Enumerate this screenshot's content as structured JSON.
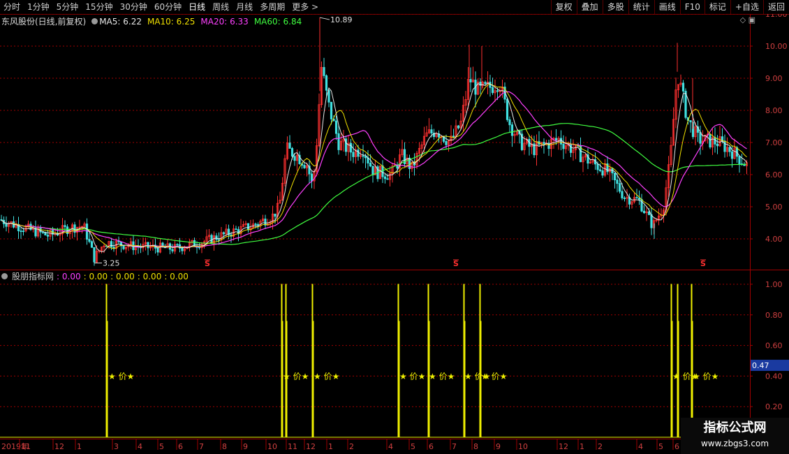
{
  "toolbar": {
    "periods": [
      "分时",
      "1分钟",
      "5分钟",
      "15分钟",
      "30分钟",
      "60分钟",
      "日线",
      "周线",
      "月线",
      "多周期"
    ],
    "active_period": "日线",
    "more": "更多 >",
    "buttons": [
      "复权",
      "叠加",
      "多股",
      "统计",
      "画线",
      "F10",
      "标记",
      "+自选",
      "返回"
    ]
  },
  "stock": {
    "name": "东风股份(日线,前复权)",
    "ma5": "MA5: 6.22",
    "ma10": "MA10: 6.25",
    "ma20": "MA20: 6.33",
    "ma60": "MA60: 6.84"
  },
  "indicator": {
    "name": "股朋指标网",
    "v1": ": 0.00",
    "v2": ": 0.00",
    "v3": ": 0.00",
    "v4": ": 0.00",
    "v5": ": 0.00"
  },
  "chart_data": [
    {
      "type": "candlestick",
      "price_axis": [
        "11.00",
        "10.00",
        "9.00",
        "8.00",
        "7.00",
        "6.00",
        "5.00",
        "4.00"
      ],
      "ylim": [
        3.0,
        11.0
      ],
      "high_label": "10.89",
      "low_label": "3.25",
      "s_markers": [
        "S",
        "S",
        "S"
      ],
      "colors": {
        "up": "#ff3030",
        "down": "#40e0e0",
        "ma5": "#e8e8e8",
        "ma10": "#f0e000",
        "ma20": "#ff40ff",
        "ma60": "#40ff40"
      }
    },
    {
      "type": "line",
      "axis": [
        "1.00",
        "0.80",
        "0.60",
        "0.40",
        "0.20"
      ],
      "ylim": [
        0.0,
        1.05
      ],
      "current_value": "0.47",
      "star_label": "★ 价★",
      "color": "#f0f000"
    }
  ],
  "xaxis": {
    "year": "2019年",
    "months": [
      "11",
      "12",
      "1",
      "3",
      "4",
      "5",
      "6",
      "7",
      "8",
      "9",
      "10",
      "11",
      "12",
      "1",
      "2",
      "4",
      "5",
      "6",
      "7",
      "8",
      "9",
      "10",
      "12",
      "1",
      "2",
      "4",
      "5",
      "6"
    ]
  },
  "watermark": {
    "title": "指标公式网",
    "url": "www.zbgs3.com"
  }
}
